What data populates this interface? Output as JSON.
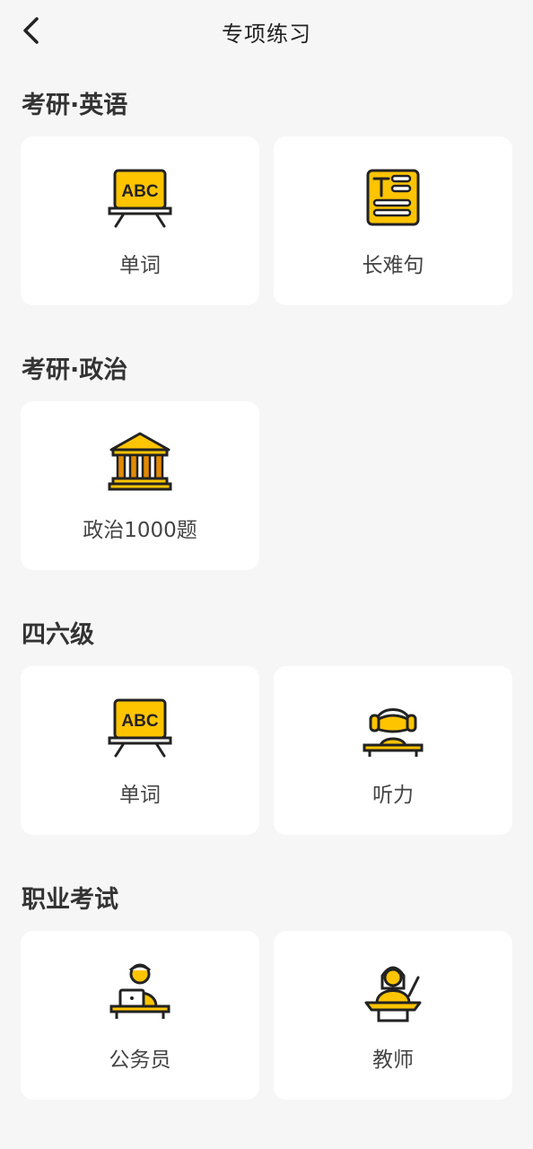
{
  "header": {
    "title": "专项练习"
  },
  "sections": [
    {
      "title": "考研·英语",
      "items": [
        {
          "label": "单词",
          "icon": "abc-board-icon"
        },
        {
          "label": "长难句",
          "icon": "text-document-icon"
        }
      ]
    },
    {
      "title": "考研·政治",
      "items": [
        {
          "label": "政治1000题",
          "icon": "government-building-icon"
        }
      ]
    },
    {
      "title": "四六级",
      "items": [
        {
          "label": "单词",
          "icon": "abc-board-icon"
        },
        {
          "label": "听力",
          "icon": "headphones-listener-icon"
        }
      ]
    },
    {
      "title": "职业考试",
      "items": [
        {
          "label": "公务员",
          "icon": "laptop-worker-icon"
        },
        {
          "label": "教师",
          "icon": "teacher-podium-icon"
        }
      ]
    }
  ],
  "colors": {
    "accent": "#FFC400",
    "outline": "#222222",
    "background": "#F6F6F6",
    "card": "#FFFFFF",
    "pillar": "#E38A00"
  }
}
